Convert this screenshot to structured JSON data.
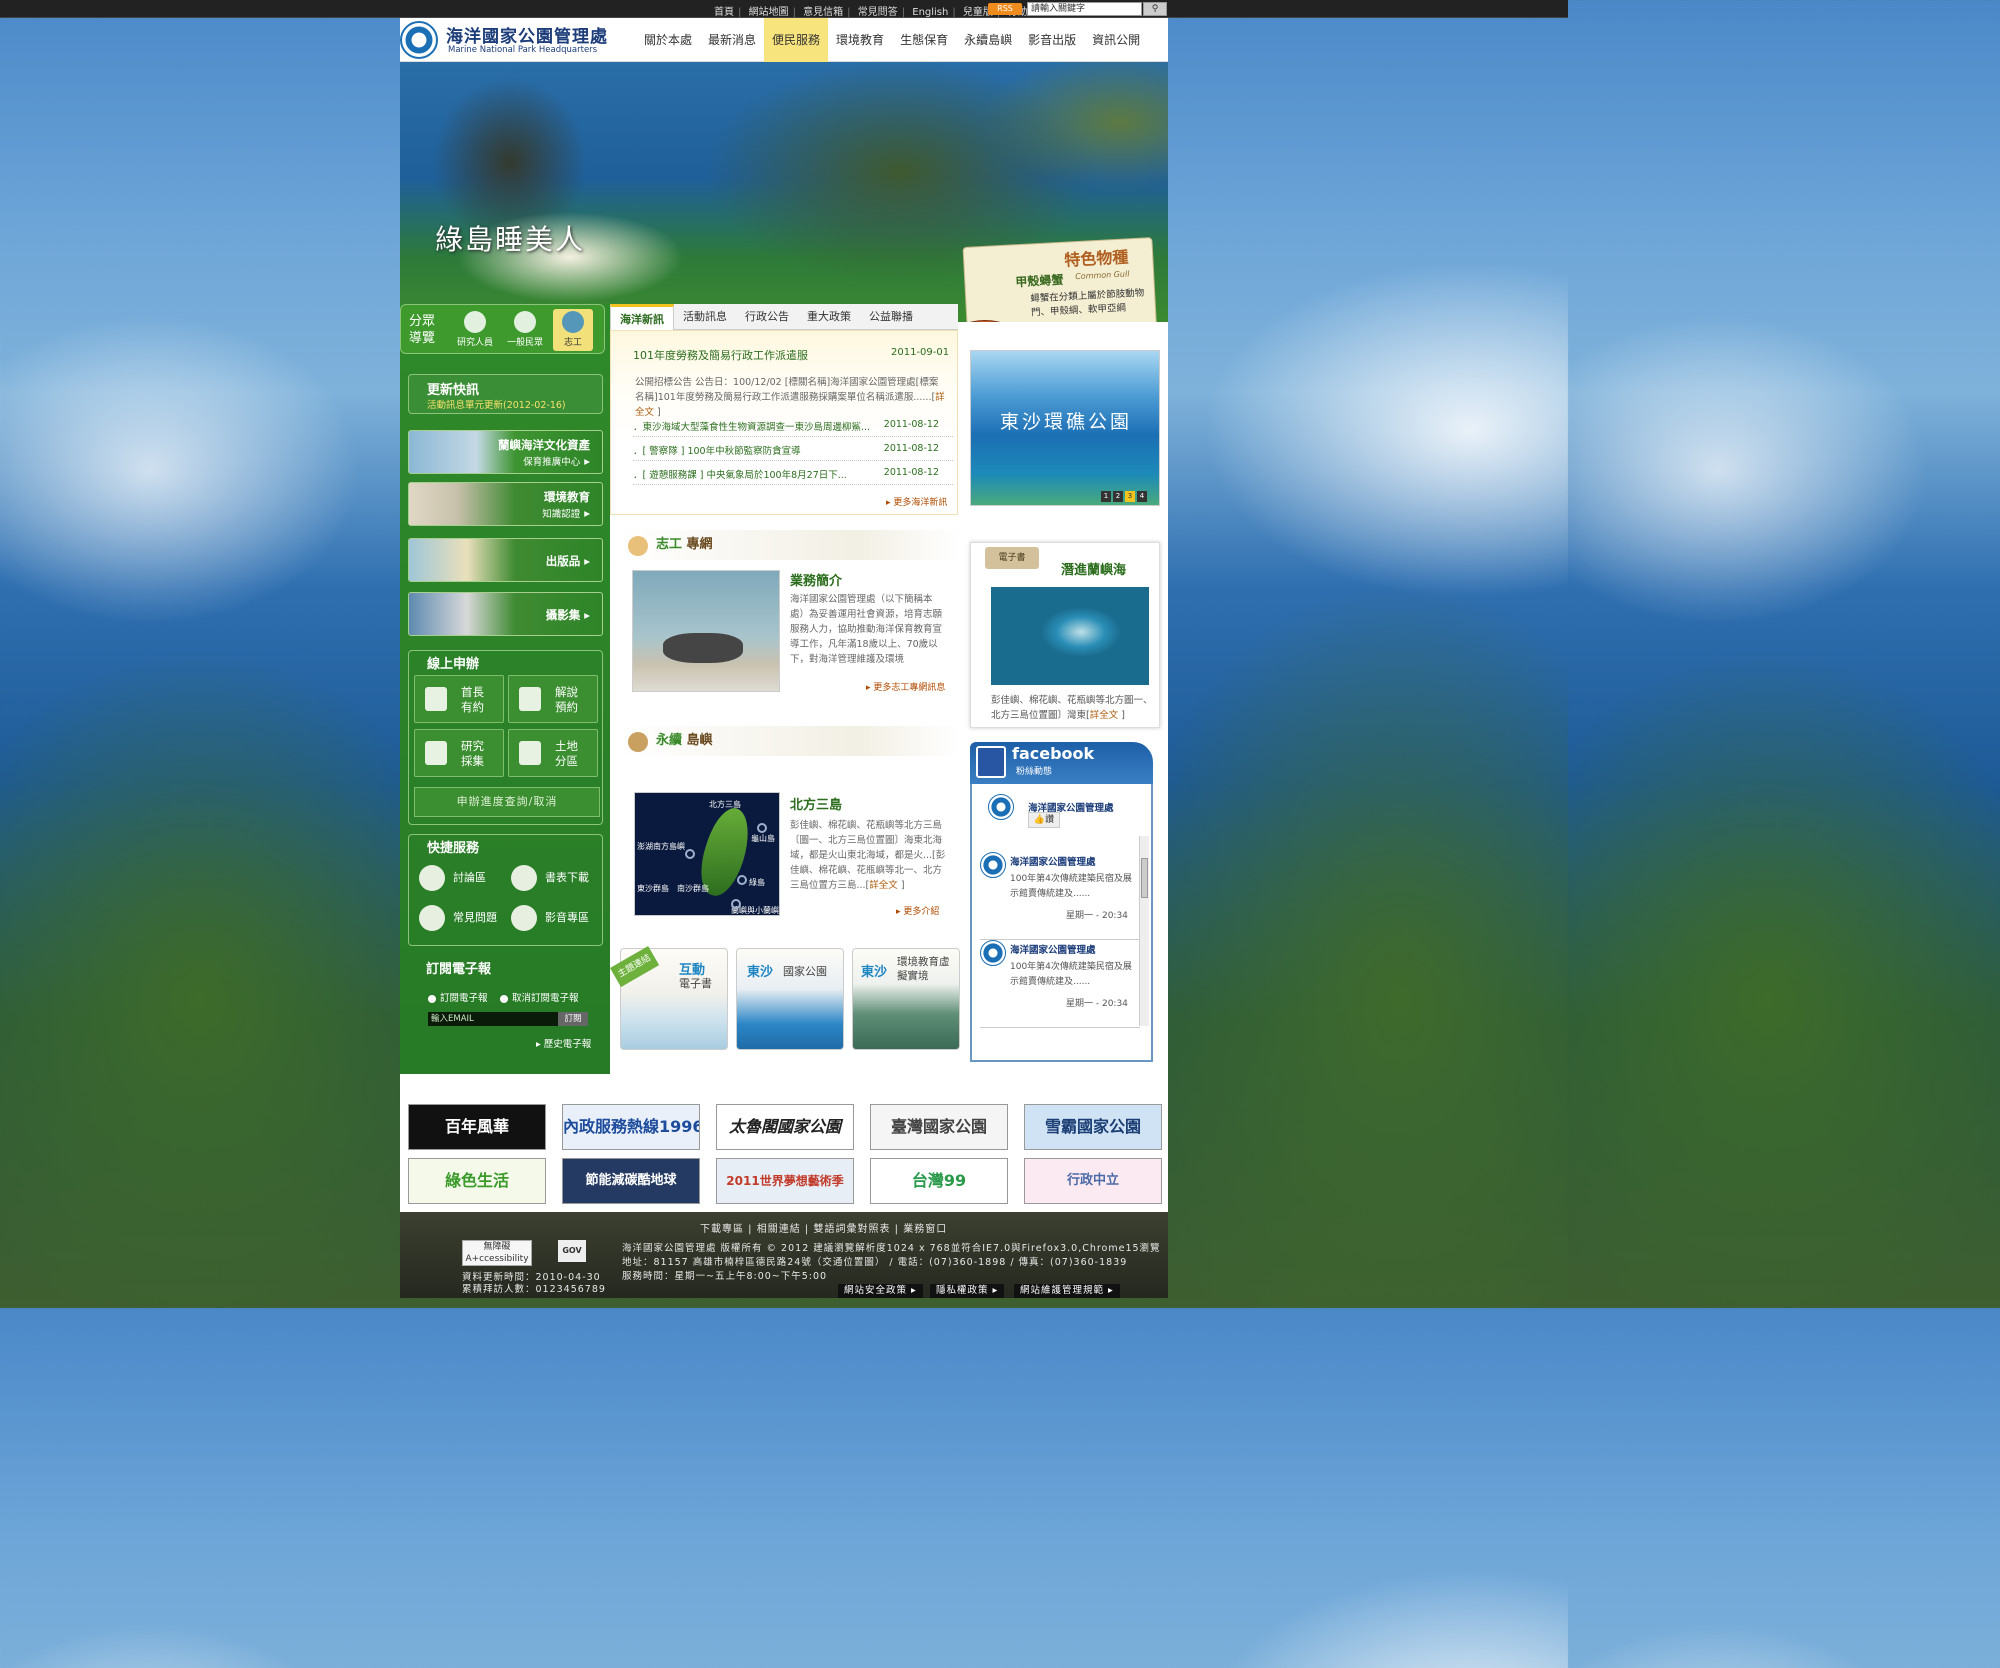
{
  "top": {
    "links": [
      "首頁",
      "網站地圖",
      "意見信箱",
      "常見問答",
      "English",
      "兒童版",
      "行動版"
    ],
    "rss": "RSS",
    "search_placeholder": "請輸入關鍵字"
  },
  "header": {
    "logo_cn": "海洋國家公園管理處",
    "logo_en": "Marine National Park Headquarters",
    "nav": [
      "關於本處",
      "最新消息",
      "便民服務",
      "環境教育",
      "生態保育",
      "永續島嶼",
      "影音出版",
      "資訊公開"
    ],
    "active_nav": "便民服務"
  },
  "hero": {
    "title": "綠島睡美人",
    "feature": {
      "title": "特色物種",
      "species": "甲殼蟳蟹",
      "species_en": "Common Gull",
      "desc": "蟳蟹在分類上屬於節肢動物門、甲殼綱、軟甲亞綱"
    }
  },
  "audience": {
    "label": "分眾導覽",
    "items": [
      "研究人員",
      "一般民眾",
      "志工"
    ]
  },
  "quicknews": {
    "title": "更新快訊",
    "text": "活動訊息單元更新(2012-02-16)"
  },
  "banners": [
    {
      "title": "蘭嶼海洋文化資產",
      "sub": "保育推廣中心"
    },
    {
      "title": "環境教育",
      "sub": "知識認證"
    },
    {
      "title": "出版品",
      "sub": ""
    },
    {
      "title": "攝影集",
      "sub": ""
    }
  ],
  "online": {
    "title": "線上申辦",
    "buttons": [
      [
        "首長",
        "有約"
      ],
      [
        "解說",
        "預約"
      ],
      [
        "研究",
        "採集"
      ],
      [
        "土地",
        "分區"
      ]
    ],
    "progress": "申辦進度查詢/取消"
  },
  "quick": {
    "title": "快捷服務",
    "items": [
      "討論區",
      "書表下載",
      "常見問題",
      "影音專區"
    ]
  },
  "epaper": {
    "title": "訂閱電子報",
    "subscribe": "訂閱電子報",
    "unsubscribe": "取消訂閱電子報",
    "email_placeholder": "輸入EMAIL",
    "button": "訂閱",
    "history": "歷史電子報"
  },
  "news": {
    "tabs": [
      "海洋新訊",
      "活動訊息",
      "行政公告",
      "重大政策",
      "公益聯播"
    ],
    "top_title": "101年度勞務及簡易行政工作派遣服",
    "top_date": "2011-09-01",
    "top_body": "公開招標公告 公告日：100/12/02 [標關名稱]海洋國家公園管理處[標案名稱]101年度勞務及簡易行政工作派遣服務採購案單位名稱派遣服......[",
    "top_more": "詳全文",
    "list": [
      {
        "t": "．東沙海域大型藻食性生物資源調查一東沙島周邊柳鯊...",
        "d": "2011-08-12"
      },
      {
        "t": "．[ 警察隊 ] 100年中秋節監察防貪宣導",
        "d": "2011-08-12"
      },
      {
        "t": "．[ 遊憩服務課 ] 中央氣象局於100年8月27日下...",
        "d": "2011-08-12"
      }
    ],
    "more": "更多海洋新訊"
  },
  "volunteer": {
    "head1": "志工",
    "head2": "專網",
    "title": "業務簡介",
    "body": "海洋國家公園管理處（以下簡稱本處）為妥善運用社會資源，培育志願服務人力，協助推動海洋保育教育宣導工作，凡年滿18歲以上、70歲以下，對海洋管理維護及環境",
    "more": "更多志工專網訊息"
  },
  "island": {
    "head1": "永續",
    "head2": "島嶼",
    "title": "北方三島",
    "body": "彭佳嶼、棉花嶼、花瓶嶼等北方三島〔圖一、北方三島位置圖〕海東北海域，都是火山東北海域，都是火...[彭佳嶼、棉花嶼、花瓶嶼等北一、北方三島位置方三島...[",
    "more_inline": "詳全文",
    "more": "更多介紹",
    "map_labels": [
      "北方三島",
      "龜山島",
      "澎湖南方島嶼",
      "綠島",
      "東沙群島",
      "南沙群島",
      "蘭嶼與小蘭嶼"
    ]
  },
  "tiles": {
    "tag": "主題連結",
    "items": [
      {
        "a": "互動",
        "b": "電子書"
      },
      {
        "a": "東沙",
        "b": "國家公園"
      },
      {
        "a": "東沙",
        "b": "環境教育虛擬實境"
      }
    ]
  },
  "slider": {
    "title": "東沙環礁公園",
    "pages": [
      "1",
      "2",
      "3",
      "4"
    ],
    "active": "3"
  },
  "ebook": {
    "label": "電子書",
    "title": "潛進蘭嶼海",
    "text": "彭佳嶼、棉花嶼、花瓶嶼等北方圖一、北方三島位置圖〕灣東[",
    "more": "詳全文"
  },
  "facebook": {
    "brand": "facebook",
    "sub": "粉絲動態",
    "page": "海洋國家公園管理處",
    "like": "讚",
    "posts": [
      {
        "n": "海洋國家公園管理處",
        "t": "100年第4次傳統建築民宿及展示館賣傳統建及......",
        "d": "星期一 - 20:34"
      },
      {
        "n": "海洋國家公園管理處",
        "t": "100年第4次傳統建築民宿及展示館賣傳統建及......",
        "d": "星期一 - 20:34"
      }
    ]
  },
  "partners": [
    "百年風華",
    "內政服務熱線1996",
    "太魯閣國家公園",
    "臺灣國家公園",
    "雪霸國家公園",
    "綠色生活",
    "節能減碳酷地球",
    "2011世界夢想藝術季",
    "台灣99",
    "行政中立"
  ],
  "footer": {
    "links": [
      "下載專區",
      "相關連結",
      "雙語詞彙對照表",
      "業務窗口"
    ],
    "acc": "無障礙 A+ccessibility",
    "gov": "GOV",
    "update": "資料更新時間：2010-04-30",
    "visits": "累積拜訪人數：0123456789",
    "line1": "海洋國家公園管理處 版權所有 © 2012 建議瀏覽解析度1024 x 768並符合IE7.0與Firefox3.0,Chrome15瀏覽",
    "line2": "地址：81157 高雄市楠梓區德民路24號（交通位置圖） / 電話：(07)360-1898 / 傳真：(07)360-1839",
    "line3": "服務時間：星期一~五上午8:00~下午5:00",
    "buttons": [
      "網站安全政策",
      "隱私權政策",
      "網站維護管理規範"
    ]
  },
  "colors": {
    "green": "#2f8a2a",
    "accent": "#f2c31e",
    "link": "#2c6e1e"
  }
}
